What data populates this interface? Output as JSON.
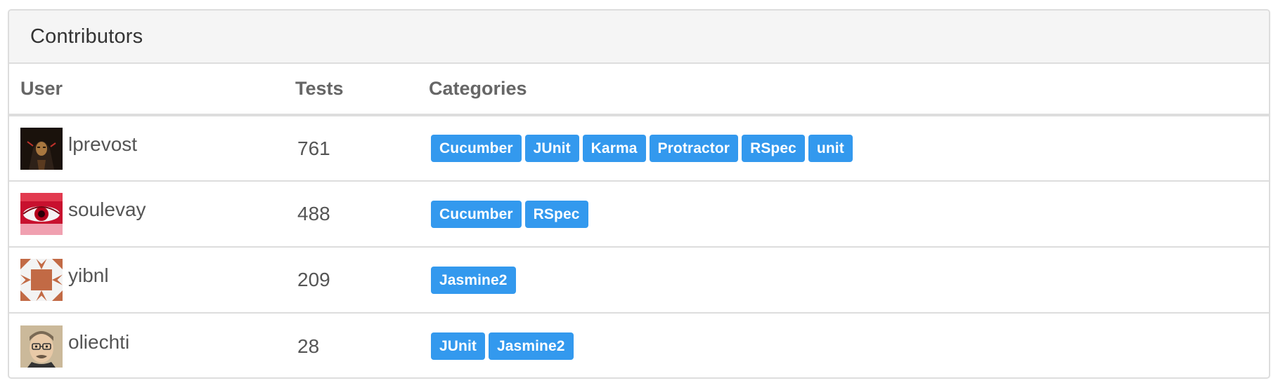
{
  "panel": {
    "title": "Contributors"
  },
  "table": {
    "headers": {
      "user": "User",
      "tests": "Tests",
      "categories": "Categories"
    },
    "rows": [
      {
        "user": "lprevost",
        "avatar_icon": "avatar-hooded-figure-icon",
        "tests": "761",
        "categories": [
          "Cucumber",
          "JUnit",
          "Karma",
          "Protractor",
          "RSpec",
          "unit"
        ]
      },
      {
        "user": "soulevay",
        "avatar_icon": "avatar-red-eye-icon",
        "tests": "488",
        "categories": [
          "Cucumber",
          "RSpec"
        ]
      },
      {
        "user": "yibnl",
        "avatar_icon": "avatar-identicon-icon",
        "tests": "209",
        "categories": [
          "Jasmine2"
        ]
      },
      {
        "user": "oliechti",
        "avatar_icon": "avatar-cartoon-face-icon",
        "tests": "28",
        "categories": [
          "JUnit",
          "Jasmine2"
        ]
      }
    ]
  },
  "colors": {
    "tag_background": "#3399ee",
    "tag_text": "#ffffff",
    "heading_background": "#f5f5f5",
    "border": "#dddddd"
  }
}
